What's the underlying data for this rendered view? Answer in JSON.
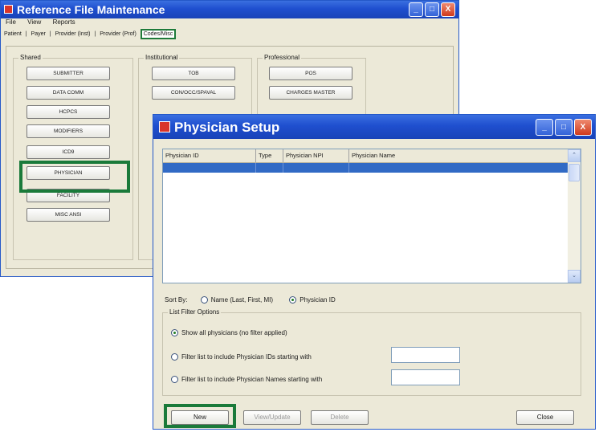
{
  "back_window": {
    "title": "Reference File Maintenance",
    "menu": [
      "File",
      "View",
      "Reports"
    ],
    "tabs": [
      "Patient",
      "Payer",
      "Provider (Inst)",
      "Provider (Prof)",
      "Codes/Misc"
    ],
    "tab_separator": "|",
    "groups": {
      "shared": {
        "label": "Shared",
        "buttons": [
          "SUBMITTER",
          "DATA COMM",
          "HCPCS",
          "MODIFIERS",
          "ICD9",
          "PHYSICIAN",
          "FACILITY",
          "MISC ANSI"
        ]
      },
      "institutional": {
        "label": "Institutional",
        "buttons": [
          "TOB",
          "CON/OCC/SPAVAL"
        ]
      },
      "professional": {
        "label": "Professional",
        "buttons": [
          "POS",
          "CHARGES MASTER"
        ]
      }
    }
  },
  "dialog": {
    "title": "Physician Setup",
    "columns": [
      "Physician ID",
      "Type",
      "Physician NPI",
      "Physician Name"
    ],
    "sort_by_label": "Sort By:",
    "sort_options": [
      {
        "label": "Name (Last, First, MI)",
        "selected": false
      },
      {
        "label": "Physician ID",
        "selected": true
      }
    ],
    "filter_group_label": "List Filter Options",
    "filter_options": [
      {
        "label": "Show all physicians (no filter applied)",
        "selected": true
      },
      {
        "label": "Filter list to include Physician IDs starting with",
        "selected": false
      },
      {
        "label": "Filter list to include Physician Names starting with",
        "selected": false
      }
    ],
    "buttons": {
      "new": "New",
      "view_update": "View/Update",
      "delete": "Delete",
      "close": "Close"
    }
  },
  "window_controls": {
    "minimize": "_",
    "maximize": "□",
    "close": "X"
  },
  "scroll_arrows": {
    "up": "⌃",
    "down": "⌄"
  },
  "highlight_color": "#1a7a3a",
  "selection_color": "#316ac5"
}
